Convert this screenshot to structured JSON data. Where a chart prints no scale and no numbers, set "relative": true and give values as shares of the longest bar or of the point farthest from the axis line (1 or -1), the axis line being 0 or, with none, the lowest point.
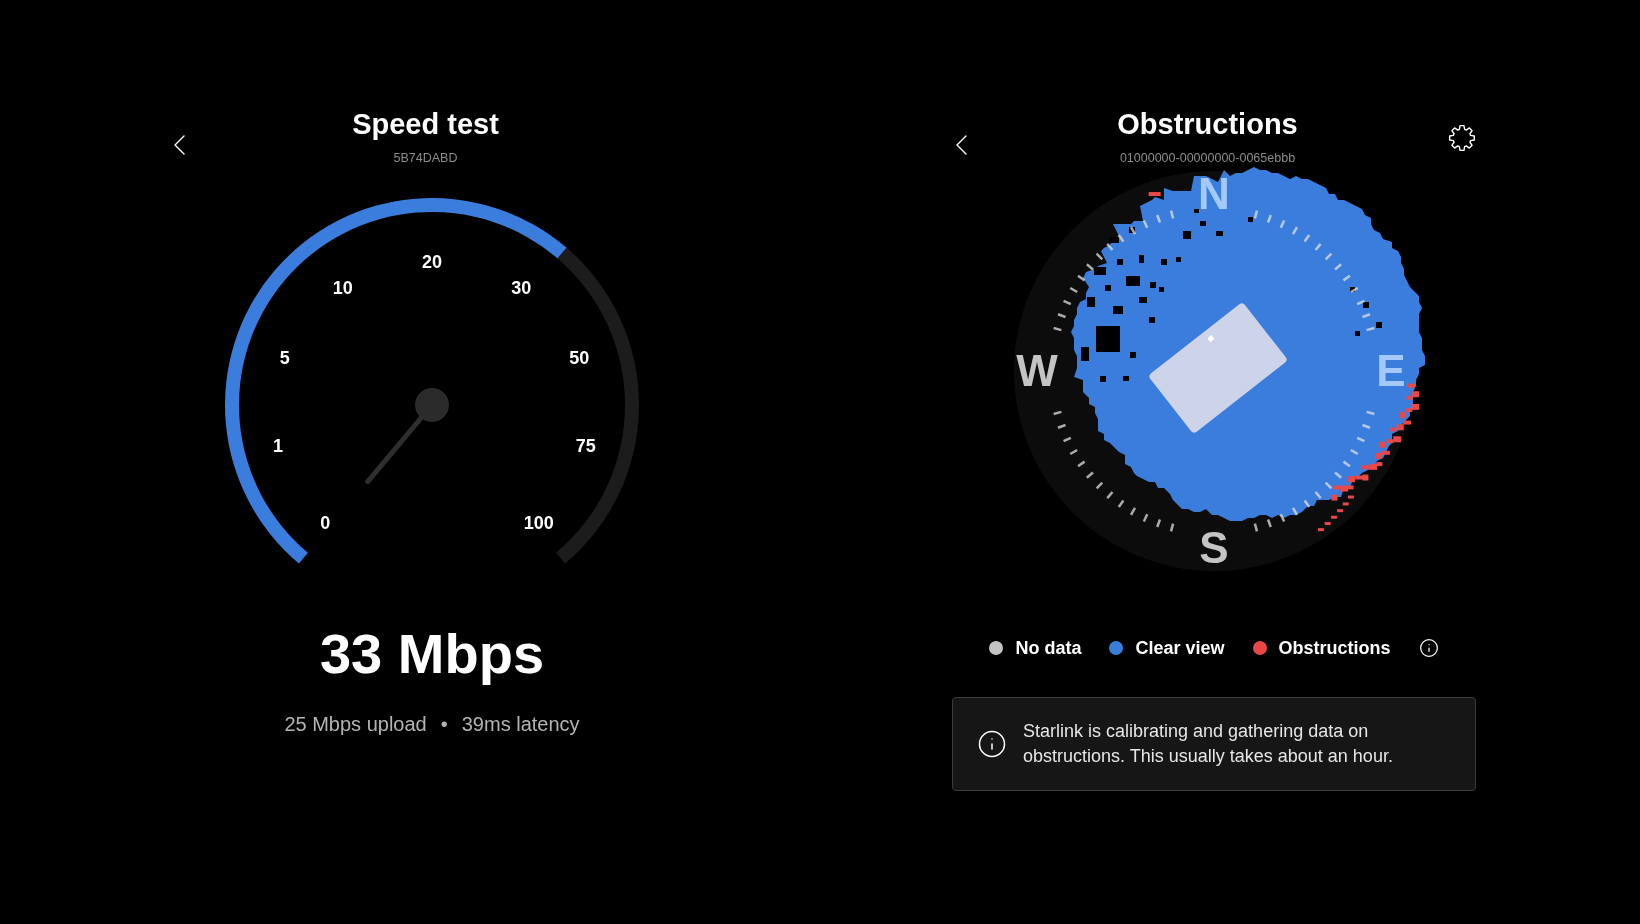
{
  "speed_test": {
    "title": "Speed test",
    "subtitle": "5B74DABD",
    "gauge": {
      "tick_labels": [
        "0",
        "1",
        "5",
        "10",
        "20",
        "30",
        "50",
        "75",
        "100"
      ],
      "chart_data": [
        {
          "type": "donut",
          "relative": true,
          "values": [
            0.645,
            0.355
          ],
          "colors": [
            "#3b7ddd",
            "#1c1c1c"
          ]
        }
      ]
    },
    "download": "33 Mbps",
    "upload": "25 Mbps upload",
    "separator": "•",
    "latency": "39ms latency"
  },
  "obstructions": {
    "title": "Obstructions",
    "subtitle": "01000000-00000000-0065ebbb",
    "map": {
      "compass": [
        "N",
        "E",
        "S",
        "W"
      ]
    },
    "legend": [
      {
        "label": "No data",
        "color": "#c4c4c4"
      },
      {
        "label": "Clear view",
        "color": "#3b7ddd"
      },
      {
        "label": "Obstructions",
        "color": "#e84848"
      }
    ],
    "notice": "Starlink is calibrating and gathering data on obstructions. This usually takes about an hour."
  }
}
